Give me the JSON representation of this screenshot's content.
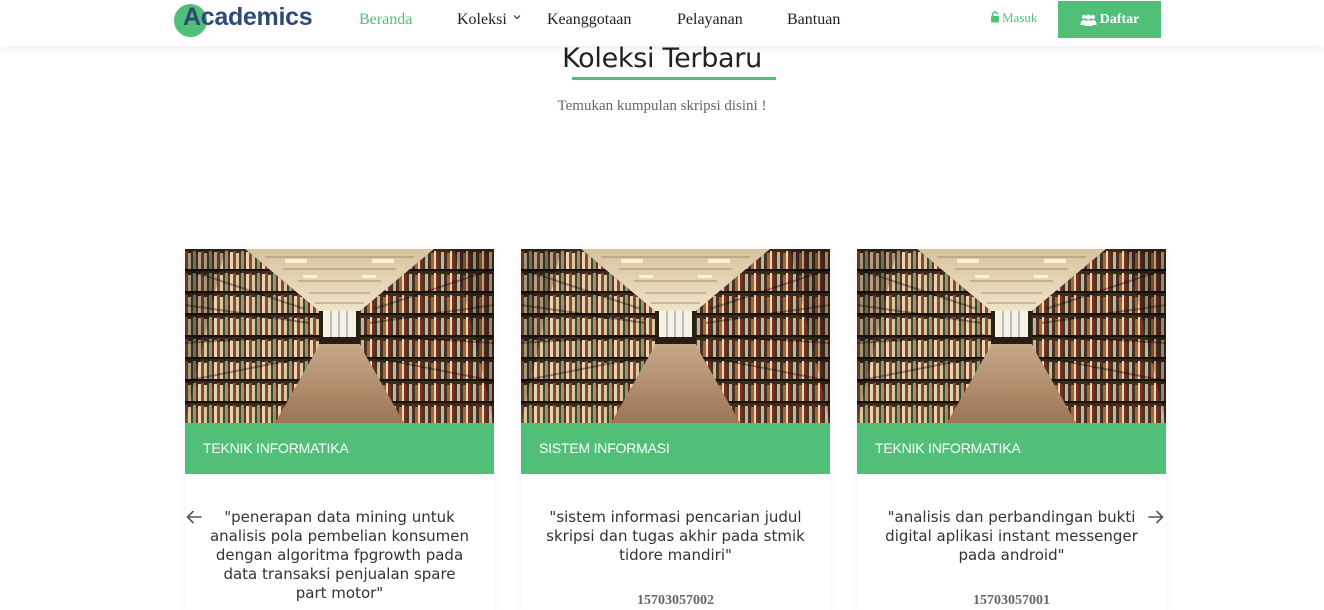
{
  "navbar": {
    "logo_text": "Academics",
    "items": [
      {
        "label": "Beranda",
        "active": true
      },
      {
        "label": "Koleksi",
        "has_dropdown": true
      },
      {
        "label": "Keanggotaan"
      },
      {
        "label": "Pelayanan"
      },
      {
        "label": "Bantuan"
      }
    ],
    "login_label": "Masuk",
    "register_label": "Daftar"
  },
  "section": {
    "title": "Koleksi Terbaru",
    "subtitle": "Temukan kumpulan skripsi disini !"
  },
  "cards": [
    {
      "category": "TEKNIK INFORMATIKA",
      "description": "\"penerapan data mining untuk analisis pola pembelian konsumen dengan algoritma fpgrowth pada data transaksi penjualan spare part motor\"",
      "id": ""
    },
    {
      "category": "SISTEM INFORMASI",
      "description": "\"sistem informasi pencarian judul skripsi dan tugas akhir pada stmik tidore mandiri\"",
      "id": "15703057002"
    },
    {
      "category": "TEKNIK INFORMATIKA",
      "description": "\"analisis dan perbandingan bukti digital aplikasi instant messenger pada android\"",
      "id": "15703057001"
    }
  ],
  "icons": {
    "lock": "lock-icon",
    "users": "users-icon",
    "chevron": "chevron-down-icon",
    "prev": "arrow-left-icon",
    "next": "arrow-right-icon"
  },
  "colors": {
    "accent": "#52bf79",
    "logo_text": "#2e4a78"
  }
}
